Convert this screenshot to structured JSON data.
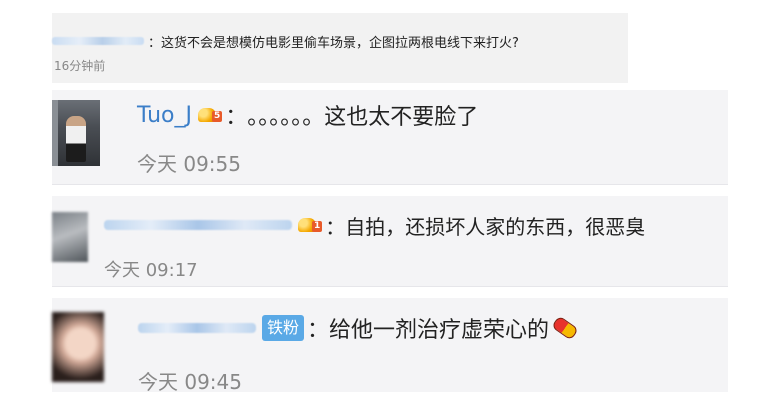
{
  "quote": {
    "colon": "：",
    "text": "这货不会是想模仿电影里偷车场景，企图拉两根电线下来打火?",
    "time": "16分钟前"
  },
  "comments": [
    {
      "username": "Tuo_J",
      "badge_level": "5",
      "colon": "：",
      "text": "。。。。。。这也太不要脸了",
      "time": "今天 09:55"
    },
    {
      "badge_level": "1",
      "colon": "：",
      "text": "自拍，还损坏人家的东西，很恶臭",
      "time": "今天 09:17"
    },
    {
      "fan_badge": "铁粉",
      "colon": "：",
      "text": "给他一剂治疗虚荣心的",
      "time": "今天 09:45"
    }
  ],
  "colors": {
    "username": "#3b7ec8",
    "comment_bg": "#f4f4f6",
    "quote_bg": "#f2f2f2",
    "fan_badge": "#5aa9e6",
    "time": "#888888"
  },
  "icons": [
    "vip-crown-icon",
    "pill-emoji-icon"
  ]
}
